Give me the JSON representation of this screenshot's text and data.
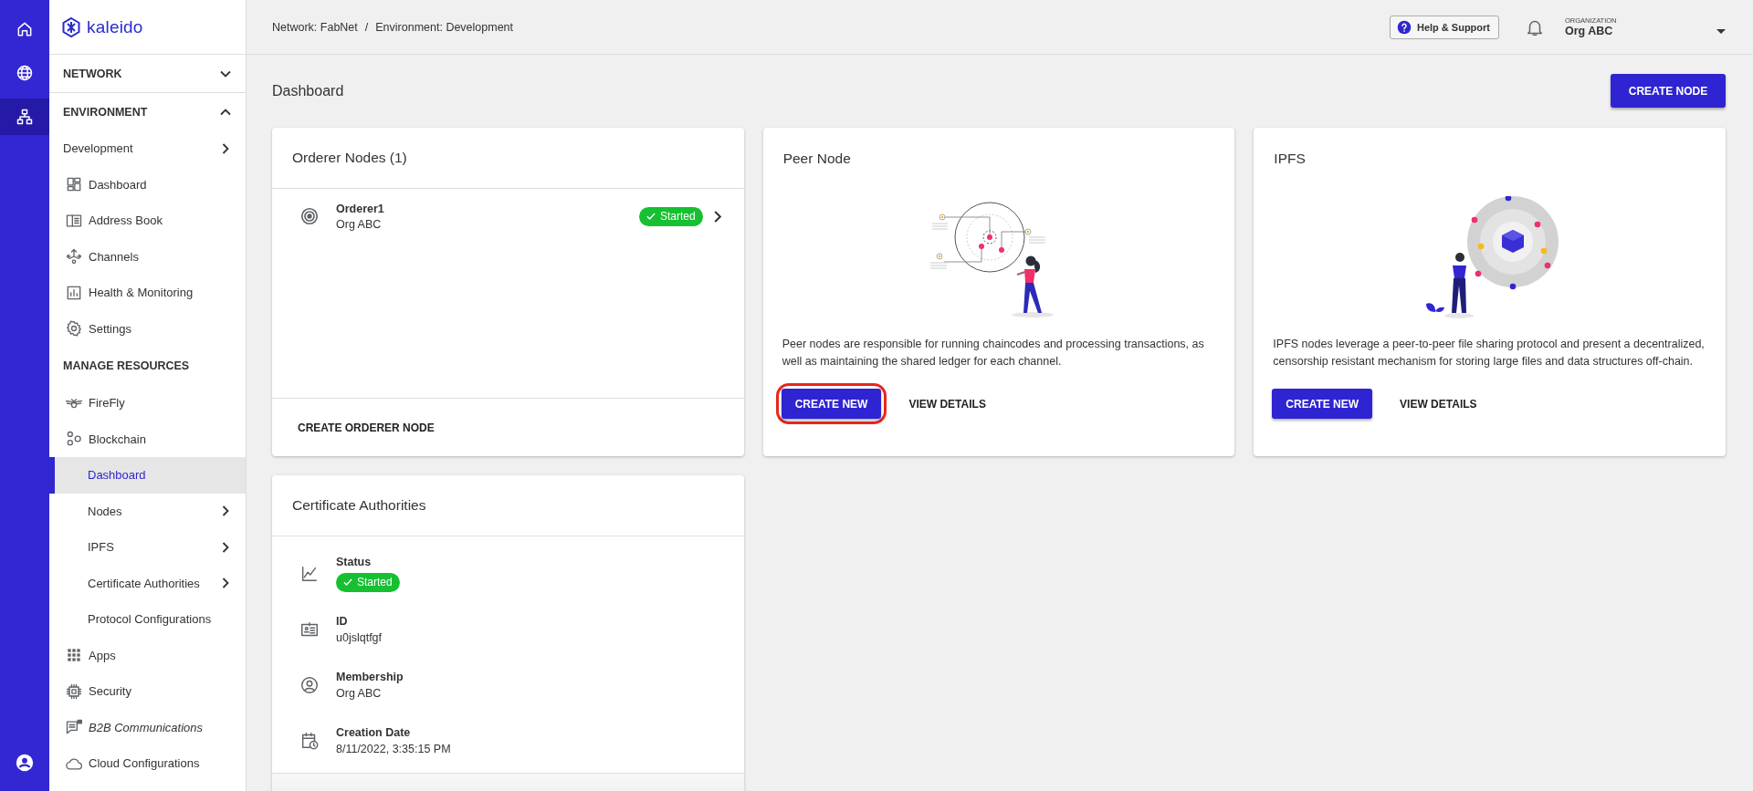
{
  "rail": {
    "items": [
      {
        "selected": false
      },
      {
        "selected": false
      },
      {
        "selected": true
      }
    ]
  },
  "sidebar": {
    "logo": "kaleido",
    "items": [
      {
        "kind": "section",
        "label": "NETWORK",
        "expanded": false
      },
      {
        "kind": "section",
        "label": "ENVIRONMENT",
        "expanded": true,
        "children": [
          {
            "kind": "group",
            "label": "Development",
            "expanded": false,
            "selected": false,
            "italic": false
          },
          {
            "kind": "link",
            "label": "Dashboard",
            "selected": false,
            "italic": false
          },
          {
            "kind": "link",
            "label": "Address Book",
            "selected": false,
            "italic": false
          },
          {
            "kind": "link",
            "label": "Channels",
            "selected": false,
            "italic": false
          },
          {
            "kind": "link",
            "label": "Health & Monitoring",
            "selected": false,
            "italic": false
          },
          {
            "kind": "link",
            "label": "Settings",
            "selected": false,
            "italic": false
          },
          {
            "kind": "heading",
            "label": "MANAGE RESOURCES"
          },
          {
            "kind": "link",
            "label": "FireFly",
            "selected": false,
            "italic": false
          },
          {
            "kind": "parent",
            "label": "Blockchain",
            "selected": false,
            "italic": false,
            "children": [
              {
                "kind": "link",
                "label": "Dashboard",
                "selected": true,
                "italic": false
              },
              {
                "kind": "group",
                "label": "Nodes",
                "expanded": false,
                "selected": false,
                "italic": false
              },
              {
                "kind": "group",
                "label": "IPFS",
                "expanded": false,
                "selected": false,
                "italic": false
              },
              {
                "kind": "group",
                "label": "Certificate Authorities",
                "expanded": false,
                "selected": false,
                "italic": false
              },
              {
                "kind": "link",
                "label": "Protocol Configurations",
                "selected": false,
                "italic": false
              }
            ]
          },
          {
            "kind": "link",
            "label": "Apps",
            "selected": false,
            "italic": false
          },
          {
            "kind": "link",
            "label": "Security",
            "selected": false,
            "italic": false
          },
          {
            "kind": "link",
            "label": "B2B Communications",
            "selected": false,
            "italic": true
          },
          {
            "kind": "link",
            "label": "Cloud Configurations",
            "selected": false,
            "italic": false
          }
        ]
      }
    ]
  },
  "topbar": {
    "breadcrumb": [
      "Network: FabNet",
      "Environment: Development"
    ],
    "separator": "/",
    "help": "Help & Support",
    "org_label": "ORGANIZATION",
    "org_value": "Org ABC"
  },
  "main": {
    "title": "Dashboard",
    "create_button": "CREATE NODE",
    "cards": [
      {
        "kind": "node_list",
        "title": "Orderer Nodes (1)",
        "nodes": [
          {
            "name": "Orderer1",
            "org": "Org ABC",
            "status": "Started"
          }
        ],
        "action": "CREATE ORDERER NODE"
      },
      {
        "kind": "info",
        "title": "Peer Node",
        "description": "Peer nodes are responsible for running chaincodes and processing transactions, as well as maintaining the shared ledger for each channel.",
        "primary": "CREATE NEW",
        "secondary": "VIEW DETAILS",
        "highlighted": true
      },
      {
        "kind": "info",
        "title": "IPFS",
        "description": "IPFS nodes leverage a peer-to-peer file sharing protocol and present a decentralized, censorship resistant mechanism for storing large files and data structures off-chain.",
        "primary": "CREATE NEW",
        "secondary": "VIEW DETAILS",
        "highlighted": false
      },
      {
        "kind": "details",
        "title": "Certificate Authorities",
        "fields": [
          {
            "kind": "status",
            "label": "Status",
            "status": "Started"
          },
          {
            "kind": "text",
            "label": "ID",
            "value": "u0jslqtfgf"
          },
          {
            "kind": "text",
            "label": "Membership",
            "value": "Org ABC"
          },
          {
            "kind": "text",
            "label": "Creation Date",
            "value": "8/11/2022, 3:35:15 PM"
          }
        ]
      }
    ]
  }
}
